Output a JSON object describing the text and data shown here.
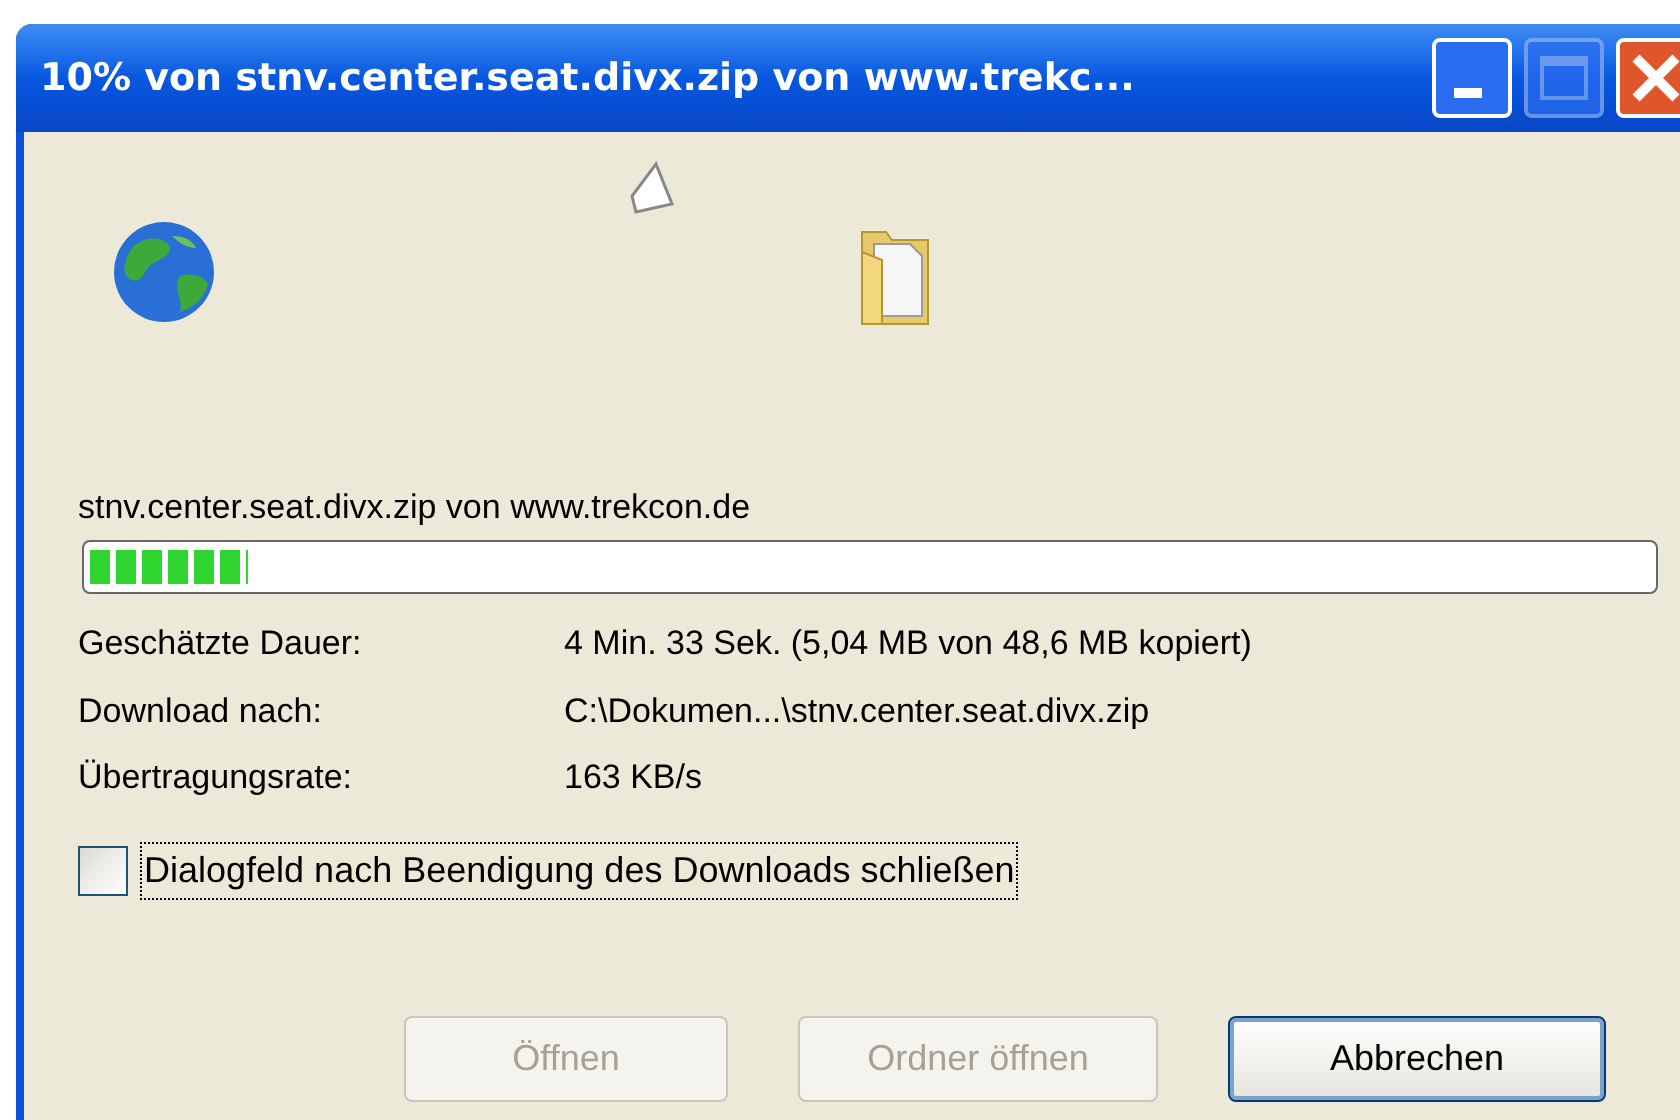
{
  "window": {
    "title": "10% von stnv.center.seat.divx.zip von www.trekc..."
  },
  "source": "stnv.center.seat.divx.zip von www.trekcon.de",
  "progress": {
    "level": 0.1
  },
  "details": [
    {
      "label": "Geschätzte Dauer:",
      "value": "4 Min. 33 Sek. (5,04 MB von 48,6 MB kopiert)"
    },
    {
      "label": "Download nach:",
      "value": "C:\\Dokumen...\\stnv.center.seat.divx.zip"
    },
    {
      "label": "Übertragungsrate:",
      "value": "163 KB/s"
    }
  ],
  "close_when_done": {
    "label": "Dialogfeld nach Beendigung des Downloads schließen",
    "checked": false
  },
  "buttons": [
    {
      "label": "Öffnen",
      "disabled": true,
      "default": false
    },
    {
      "label": "Ordner öffnen",
      "disabled": true,
      "default": false
    },
    {
      "label": "Abbrechen",
      "disabled": false,
      "default": true
    }
  ]
}
